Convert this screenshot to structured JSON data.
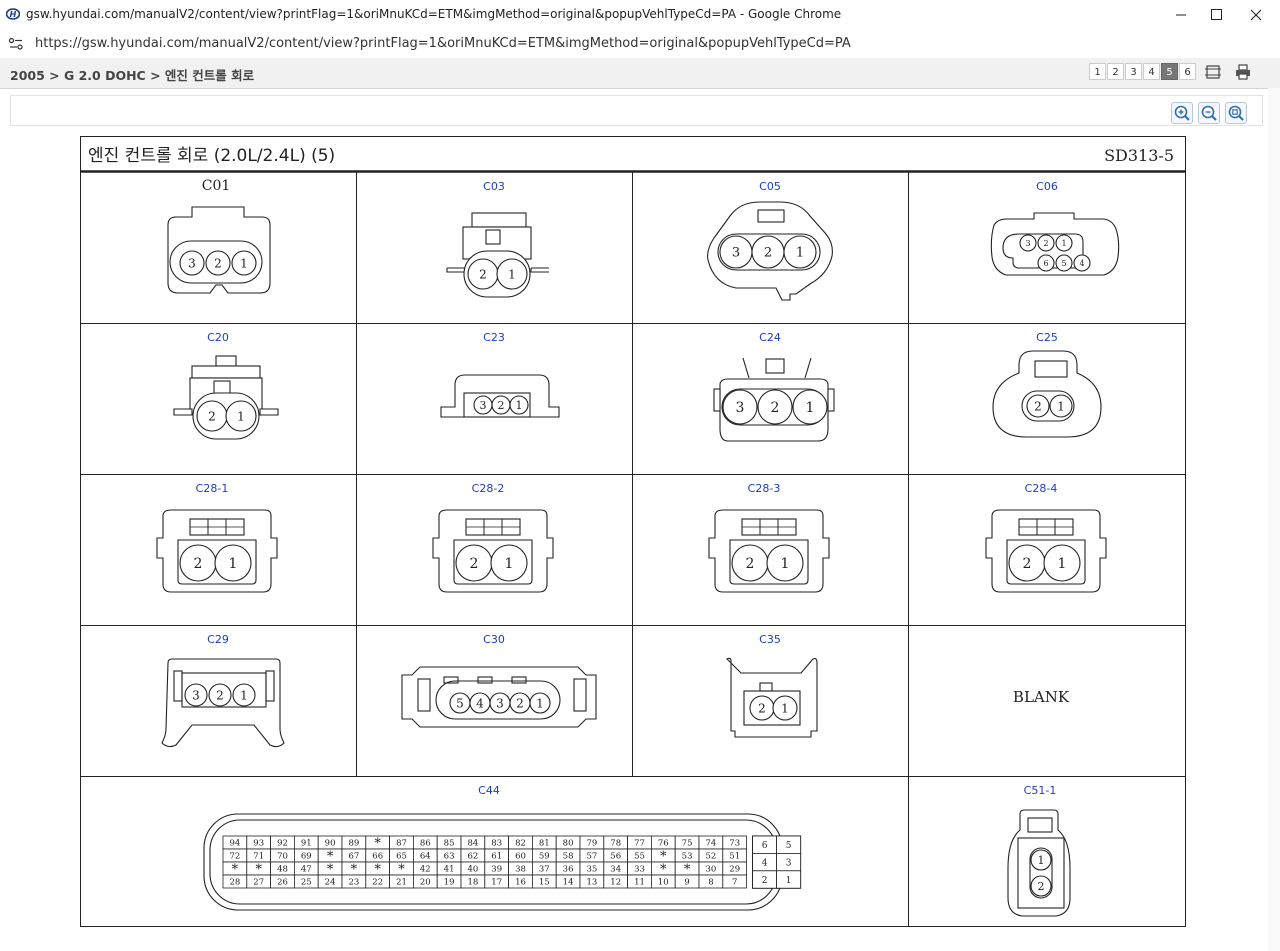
{
  "window": {
    "title": "gsw.hyundai.com/manualV2/content/view?printFlag=1&oriMnuKCd=ETM&imgMethod=original&popupVehlTypeCd=PA - Google Chrome",
    "url": "https://gsw.hyundai.com/manualV2/content/view?printFlag=1&oriMnuKCd=ETM&imgMethod=original&popupVehlTypeCd=PA"
  },
  "breadcrumb": "2005 > G 2.0 DOHC > 엔진 컨트롤 회로",
  "pages": [
    "1",
    "2",
    "3",
    "4",
    "5",
    "6"
  ],
  "active_page": "5",
  "diagram": {
    "title": "엔진 컨트롤 회로 (2.0L/2.4L) (5)",
    "code": "SD313-5",
    "connectors": [
      {
        "label": "C01",
        "pins": [
          "3",
          "2",
          "1"
        ]
      },
      {
        "label": "C03",
        "pins": [
          "2",
          "1"
        ]
      },
      {
        "label": "C05",
        "pins": [
          "3",
          "2",
          "1"
        ]
      },
      {
        "label": "C06",
        "pins": [
          "3",
          "2",
          "1",
          "6",
          "5",
          "4"
        ]
      },
      {
        "label": "C20",
        "pins": [
          "2",
          "1"
        ]
      },
      {
        "label": "C23",
        "pins": [
          "3",
          "2",
          "1"
        ]
      },
      {
        "label": "C24",
        "pins": [
          "3",
          "2",
          "1"
        ]
      },
      {
        "label": "C25",
        "pins": [
          "2",
          "1"
        ]
      },
      {
        "label": "C28-1",
        "pins": [
          "2",
          "1"
        ]
      },
      {
        "label": "C28-2",
        "pins": [
          "2",
          "1"
        ]
      },
      {
        "label": "C28-3",
        "pins": [
          "2",
          "1"
        ]
      },
      {
        "label": "C28-4",
        "pins": [
          "2",
          "1"
        ]
      },
      {
        "label": "C29",
        "pins": [
          "3",
          "2",
          "1"
        ]
      },
      {
        "label": "C30",
        "pins": [
          "5",
          "4",
          "3",
          "2",
          "1"
        ]
      },
      {
        "label": "C35",
        "pins": [
          "2",
          "1"
        ]
      },
      {
        "label": "",
        "text": "BLANK"
      },
      {
        "label": "C44",
        "rows": [
          [
            "94",
            "93",
            "92",
            "91",
            "90",
            "89",
            "*",
            "87",
            "86",
            "85",
            "84",
            "83",
            "82",
            "81",
            "80",
            "79",
            "78",
            "77",
            "76",
            "75",
            "74",
            "73"
          ],
          [
            "72",
            "71",
            "70",
            "69",
            "*",
            "67",
            "66",
            "65",
            "64",
            "63",
            "62",
            "61",
            "60",
            "59",
            "58",
            "57",
            "56",
            "55",
            "*",
            "53",
            "52",
            "51"
          ],
          [
            "*",
            "*",
            "48",
            "47",
            "*",
            "*",
            "*",
            "*",
            "42",
            "41",
            "40",
            "39",
            "38",
            "37",
            "36",
            "35",
            "34",
            "33",
            "*",
            "*",
            "30",
            "29"
          ],
          [
            "28",
            "27",
            "26",
            "25",
            "24",
            "23",
            "22",
            "21",
            "20",
            "19",
            "18",
            "17",
            "16",
            "15",
            "14",
            "13",
            "12",
            "11",
            "10",
            "9",
            "8",
            "7"
          ]
        ],
        "side": [
          [
            "6",
            "5"
          ],
          [
            "4",
            "3"
          ],
          [
            "2",
            "1"
          ]
        ]
      },
      {
        "label": "C51-1",
        "pins": [
          "1",
          "2"
        ]
      }
    ]
  },
  "colors": {
    "label_blue": "#1a3fbf",
    "ink": "#222222"
  }
}
